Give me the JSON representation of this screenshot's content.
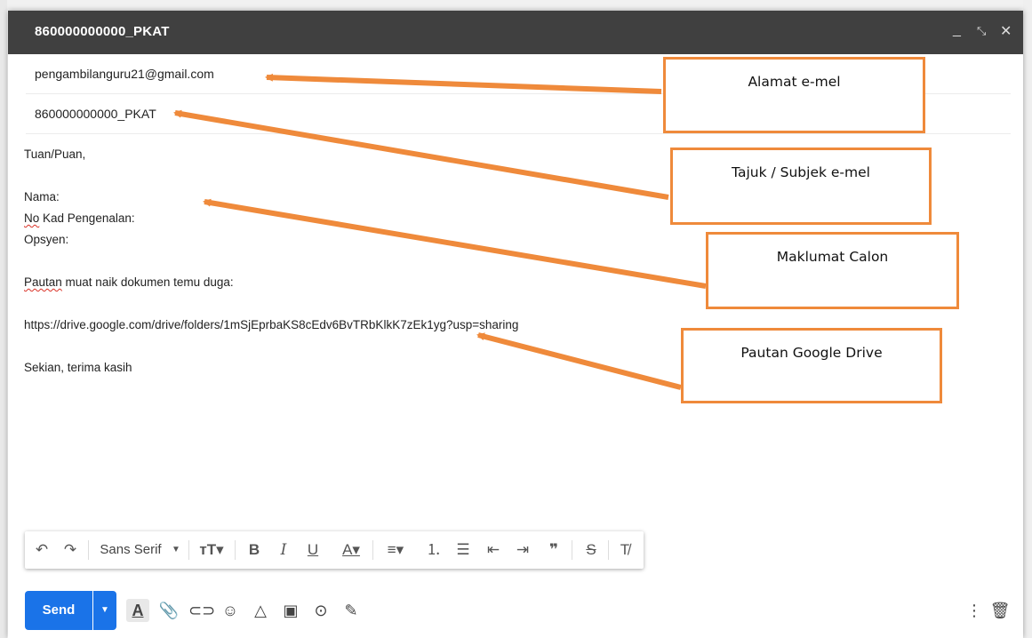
{
  "window": {
    "title": "860000000000_PKAT",
    "controls": [
      "minimize-icon",
      "expand-icon",
      "close-icon"
    ]
  },
  "fields": {
    "to": "pengambilanguru21@gmail.com",
    "subject": "860000000000_PKAT"
  },
  "body": {
    "greeting": "Tuan/Puan,",
    "nama": "Nama:",
    "no_kad_word": "No",
    "no_kad_rest": " Kad Pengenalan:",
    "opsyen": "Opsyen:",
    "pautan_word": "Pautan",
    "pautan_rest": " muat naik dokumen temu duga:",
    "link": "https://drive.google.com/drive/folders/1mSjEprbaKS8cEdv6BvTRbKlkK7zEk1yg?usp=sharing",
    "closing": "Sekian, terima kasih"
  },
  "format_bar": {
    "font": "Sans Serif",
    "icons": [
      "undo-icon",
      "redo-icon",
      "font-dropdown-icon",
      "text-size-icon",
      "bold-icon",
      "italic-icon",
      "underline-icon",
      "text-color-icon",
      "align-icon",
      "numbered-list-icon",
      "bulleted-list-icon",
      "indent-less-icon",
      "indent-more-icon",
      "quote-icon",
      "strikethrough-icon",
      "clear-formatting-icon"
    ]
  },
  "bottom_bar": {
    "send_label": "Send",
    "icons": [
      "send-options-icon",
      "formatting-options-icon",
      "attach-icon",
      "link-icon",
      "emoji-icon",
      "drive-icon",
      "image-icon",
      "confidential-icon",
      "signature-icon",
      "more-options-icon",
      "discard-icon"
    ]
  },
  "callouts": {
    "address": "Alamat e-mel",
    "subject": "Tajuk / Subjek e-mel",
    "candidate": "Maklumat Calon",
    "drive": "Pautan Google Drive"
  },
  "colors": {
    "titlebar": "#404040",
    "send": "#1a73e8",
    "callout_border": "#ef8a3b",
    "arrow": "#ef8a3b"
  }
}
